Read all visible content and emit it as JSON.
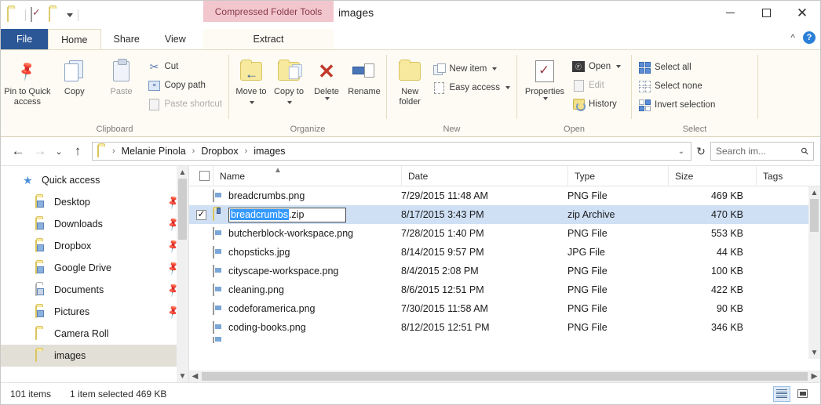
{
  "window": {
    "title": "images",
    "contextual_tab_group": "Compressed Folder Tools",
    "minimize_label": "Minimize",
    "maximize_label": "Maximize",
    "close_label": "Close",
    "collapse_ribbon_label": "^",
    "help_label": "?"
  },
  "quick_access_toolbar": {
    "icons": [
      "folder-icon",
      "properties-icon",
      "new-folder-icon",
      "customize-dropdown-icon"
    ]
  },
  "tabs": [
    {
      "label": "File",
      "state": "file"
    },
    {
      "label": "Home",
      "state": "active"
    },
    {
      "label": "Share",
      "state": "normal"
    },
    {
      "label": "View",
      "state": "normal"
    },
    {
      "label": "Extract",
      "state": "contextual"
    }
  ],
  "ribbon": {
    "groups": [
      {
        "name": "Clipboard",
        "label": "Clipboard",
        "big_buttons": [
          {
            "label": "Pin to Quick access",
            "icon": "pin-icon"
          },
          {
            "label": "Copy",
            "icon": "copy-icon"
          },
          {
            "label": "Paste",
            "icon": "paste-icon"
          }
        ],
        "small_buttons": [
          {
            "label": "Cut",
            "icon": "scissors-icon",
            "enabled": true
          },
          {
            "label": "Copy path",
            "icon": "copy-path-icon",
            "enabled": true
          },
          {
            "label": "Paste shortcut",
            "icon": "paste-shortcut-icon",
            "enabled": false
          }
        ]
      },
      {
        "name": "Organize",
        "label": "Organize",
        "big_buttons": [
          {
            "label": "Move to",
            "icon": "move-to-icon",
            "has_dropdown": true
          },
          {
            "label": "Copy to",
            "icon": "copy-to-icon",
            "has_dropdown": true
          },
          {
            "label": "Delete",
            "icon": "delete-icon",
            "has_dropdown": true
          },
          {
            "label": "Rename",
            "icon": "rename-icon"
          }
        ]
      },
      {
        "name": "New",
        "label": "New",
        "big_buttons": [
          {
            "label": "New folder",
            "icon": "new-folder-icon"
          }
        ],
        "small_buttons": [
          {
            "label": "New item",
            "icon": "new-item-icon",
            "has_dropdown": true,
            "enabled": true
          },
          {
            "label": "Easy access",
            "icon": "easy-access-icon",
            "has_dropdown": true,
            "enabled": true
          }
        ]
      },
      {
        "name": "Open",
        "label": "Open",
        "big_buttons": [
          {
            "label": "Properties",
            "icon": "properties-icon",
            "has_dropdown": true
          }
        ],
        "small_buttons": [
          {
            "label": "Open",
            "icon": "open-icon",
            "has_dropdown": true,
            "enabled": true
          },
          {
            "label": "Edit",
            "icon": "edit-icon",
            "enabled": false
          },
          {
            "label": "History",
            "icon": "history-icon",
            "enabled": true
          }
        ]
      },
      {
        "name": "Select",
        "label": "Select",
        "small_buttons": [
          {
            "label": "Select all",
            "icon": "select-all-icon",
            "enabled": true
          },
          {
            "label": "Select none",
            "icon": "select-none-icon",
            "enabled": true
          },
          {
            "label": "Invert selection",
            "icon": "invert-selection-icon",
            "enabled": true
          }
        ]
      }
    ]
  },
  "address_bar": {
    "back_label": "←",
    "forward_label": "→",
    "recent_label": "⌄",
    "up_label": "↑",
    "breadcrumbs": [
      "Melanie Pinola",
      "Dropbox",
      "images"
    ],
    "separator": "›",
    "dropdown_label": "⌄",
    "refresh_label": "↻"
  },
  "search": {
    "placeholder": "Search im...",
    "icon": "search-icon"
  },
  "sidebar": {
    "items": [
      {
        "label": "Quick access",
        "icon": "star-icon",
        "level": "root",
        "pinned": false,
        "selected": false
      },
      {
        "label": "Desktop",
        "icon": "folder-desktop-icon",
        "level": "child",
        "pinned": true,
        "selected": false
      },
      {
        "label": "Downloads",
        "icon": "folder-downloads-icon",
        "level": "child",
        "pinned": true,
        "selected": false
      },
      {
        "label": "Dropbox",
        "icon": "folder-dropbox-icon",
        "level": "child",
        "pinned": true,
        "selected": false
      },
      {
        "label": "Google Drive",
        "icon": "folder-googledrive-icon",
        "level": "child",
        "pinned": true,
        "selected": false
      },
      {
        "label": "Documents",
        "icon": "folder-documents-icon",
        "level": "child",
        "pinned": true,
        "selected": false
      },
      {
        "label": "Pictures",
        "icon": "folder-pictures-icon",
        "level": "child",
        "pinned": true,
        "selected": false
      },
      {
        "label": "Camera Roll",
        "icon": "folder-icon",
        "level": "child",
        "pinned": false,
        "selected": false
      },
      {
        "label": "images",
        "icon": "folder-icon",
        "level": "child",
        "pinned": false,
        "selected": true
      }
    ]
  },
  "file_list": {
    "columns": [
      "Name",
      "Date",
      "Type",
      "Size",
      "Tags"
    ],
    "sort_column": "Name",
    "sort_direction": "ascending",
    "rows": [
      {
        "name": "breadcrumbs.png",
        "date": "7/29/2015 11:48 AM",
        "type": "PNG File",
        "size": "469 KB",
        "tags": "",
        "icon": "image-file-icon",
        "checked": false,
        "selected": false,
        "renaming": false
      },
      {
        "name": "breadcrumbs.zip",
        "date": "8/17/2015 3:43 PM",
        "type": "zip Archive",
        "size": "470 KB",
        "tags": "",
        "icon": "zip-file-icon",
        "checked": true,
        "selected": true,
        "renaming": true,
        "rename_selected_text": "breadcrumbs",
        "rename_rest_text": ".zip"
      },
      {
        "name": "butcherblock-workspace.png",
        "date": "7/28/2015 1:40 PM",
        "type": "PNG File",
        "size": "553 KB",
        "tags": "",
        "icon": "image-file-icon",
        "checked": false,
        "selected": false,
        "renaming": false
      },
      {
        "name": "chopsticks.jpg",
        "date": "8/14/2015 9:57 PM",
        "type": "JPG File",
        "size": "44 KB",
        "tags": "",
        "icon": "image-file-icon",
        "checked": false,
        "selected": false,
        "renaming": false
      },
      {
        "name": "cityscape-workspace.png",
        "date": "8/4/2015 2:08 PM",
        "type": "PNG File",
        "size": "100 KB",
        "tags": "",
        "icon": "image-file-icon",
        "checked": false,
        "selected": false,
        "renaming": false
      },
      {
        "name": "cleaning.png",
        "date": "8/6/2015 12:51 PM",
        "type": "PNG File",
        "size": "422 KB",
        "tags": "",
        "icon": "image-file-icon",
        "checked": false,
        "selected": false,
        "renaming": false
      },
      {
        "name": "codeforamerica.png",
        "date": "7/30/2015 11:58 AM",
        "type": "PNG File",
        "size": "90 KB",
        "tags": "",
        "icon": "image-file-icon",
        "checked": false,
        "selected": false,
        "renaming": false
      },
      {
        "name": "coding-books.png",
        "date": "8/12/2015 12:51 PM",
        "type": "PNG File",
        "size": "346 KB",
        "tags": "",
        "icon": "image-file-icon",
        "checked": false,
        "selected": false,
        "renaming": false
      }
    ]
  },
  "status_bar": {
    "item_count": "101 items",
    "selection": "1 item selected  469 KB",
    "view_details_label": "Details view",
    "view_icons_label": "Large icons view"
  },
  "colors": {
    "accent": "#2b5797",
    "contextual_tab": "#f2c6cd",
    "selection_row": "#cfe0f5",
    "rename_selection": "#3399ff",
    "ribbon_bg": "#fdfbf3",
    "folder_yellow": "#f7e99e"
  }
}
